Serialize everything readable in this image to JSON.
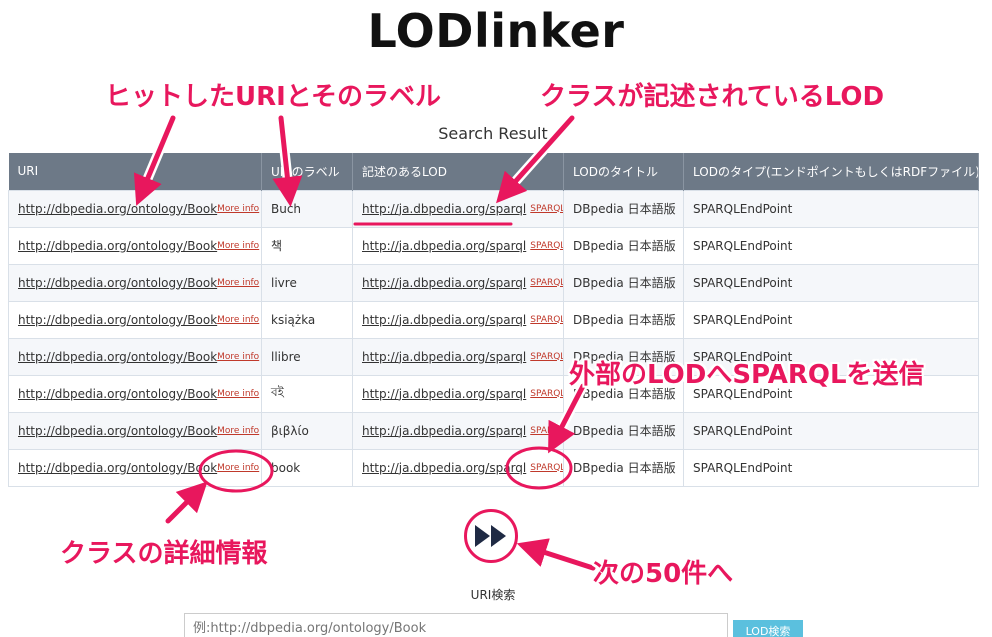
{
  "app": {
    "title": "LODlinker"
  },
  "results": {
    "title": "Search Result",
    "headers": [
      "URI",
      "URIのラベル",
      "記述のあるLOD",
      "LODのタイトル",
      "LODのタイプ(エンドポイントもしくはRDFファイル)"
    ],
    "rows": [
      {
        "uri": "http://dbpedia.org/ontology/Book",
        "more": "More info",
        "label": "Buch",
        "lod": "http://ja.dbpedia.org/sparql",
        "sparql": "SPARQL",
        "title": "DBpedia 日本語版",
        "type": "SPARQLEndPoint"
      },
      {
        "uri": "http://dbpedia.org/ontology/Book",
        "more": "More info",
        "label": "책",
        "lod": "http://ja.dbpedia.org/sparql",
        "sparql": "SPARQL",
        "title": "DBpedia 日本語版",
        "type": "SPARQLEndPoint"
      },
      {
        "uri": "http://dbpedia.org/ontology/Book",
        "more": "More info",
        "label": "livre",
        "lod": "http://ja.dbpedia.org/sparql",
        "sparql": "SPARQL",
        "title": "DBpedia 日本語版",
        "type": "SPARQLEndPoint"
      },
      {
        "uri": "http://dbpedia.org/ontology/Book",
        "more": "More info",
        "label": "książka",
        "lod": "http://ja.dbpedia.org/sparql",
        "sparql": "SPARQL",
        "title": "DBpedia 日本語版",
        "type": "SPARQLEndPoint"
      },
      {
        "uri": "http://dbpedia.org/ontology/Book",
        "more": "More info",
        "label": "llibre",
        "lod": "http://ja.dbpedia.org/sparql",
        "sparql": "SPARQL",
        "title": "DBpedia 日本語版",
        "type": "SPARQLEndPoint"
      },
      {
        "uri": "http://dbpedia.org/ontology/Book",
        "more": "More info",
        "label": "বই",
        "lod": "http://ja.dbpedia.org/sparql",
        "sparql": "SPARQL",
        "title": "DBpedia 日本語版",
        "type": "SPARQLEndPoint"
      },
      {
        "uri": "http://dbpedia.org/ontology/Book",
        "more": "More info",
        "label": "βιβλίο",
        "lod": "http://ja.dbpedia.org/sparql",
        "sparql": "SPARQL",
        "title": "DBpedia 日本語版",
        "type": "SPARQLEndPoint"
      },
      {
        "uri": "http://dbpedia.org/ontology/Book",
        "more": "More info",
        "label": "book",
        "lod": "http://ja.dbpedia.org/sparql",
        "sparql": "SPARQL",
        "title": "DBpedia 日本語版",
        "type": "SPARQLEndPoint"
      }
    ]
  },
  "pager": {
    "next_icon": "fast-forward-icon"
  },
  "search": {
    "label": "URI検索",
    "placeholder": "例:http://dbpedia.org/ontology/Book",
    "button": "LOD検索"
  },
  "annotations": {
    "hit_uri": "ヒットしたURIとそのラベル",
    "class_lod": "クラスが記述されているLOD",
    "send_sparql": "外部のLODへSPARQLを送信",
    "class_detail": "クラスの詳細情報",
    "next_50": "次の50件へ"
  },
  "colors": {
    "accent": "#e8175d",
    "header_bg": "#6d7987",
    "link_red": "#c0392b",
    "button": "#5bc0de"
  }
}
